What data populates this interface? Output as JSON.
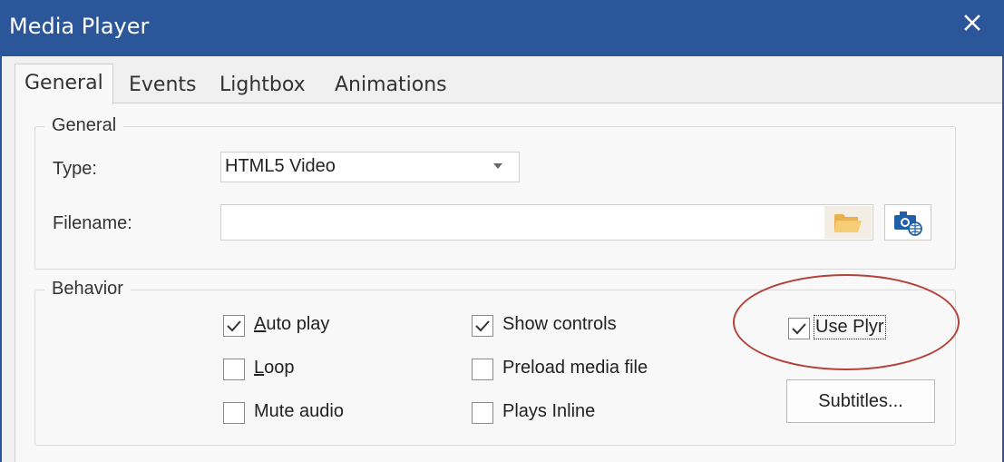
{
  "window": {
    "title": "Media Player",
    "accent_color": "#2b579a",
    "close_icon": "close-icon"
  },
  "tabs": [
    {
      "label": "General",
      "active": true
    },
    {
      "label": "Events",
      "active": false
    },
    {
      "label": "Lightbox",
      "active": false
    },
    {
      "label": "Animations",
      "active": false
    }
  ],
  "general_group": {
    "label": "General",
    "type_label": "Type:",
    "type_value": "HTML5 Video",
    "filename_label": "Filename:",
    "filename_value": "",
    "browse_icon": "folder-icon",
    "web_icon": "camera-globe-icon"
  },
  "behavior_group": {
    "label": "Behavior",
    "checkboxes": [
      {
        "label": "Auto play",
        "checked": true
      },
      {
        "label": "Loop",
        "checked": false
      },
      {
        "label": "Mute audio",
        "checked": false
      },
      {
        "label": "Show controls",
        "checked": true
      },
      {
        "label": "Preload media file",
        "checked": false
      },
      {
        "label": "Plays Inline",
        "checked": false
      },
      {
        "label": "Use Plyr",
        "checked": true
      }
    ],
    "subtitles_button": "Subtitles..."
  },
  "annotation": {
    "highlight_color": "#b4423a"
  }
}
